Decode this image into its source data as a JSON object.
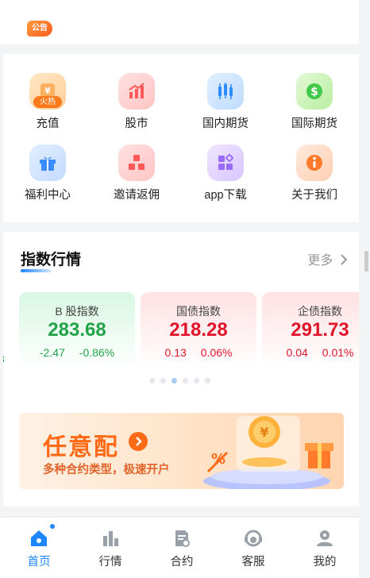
{
  "notice": {
    "badge": "公告"
  },
  "menu": [
    {
      "label": "充值",
      "icon": "recharge-icon",
      "tag": "火热",
      "color": "#ffb05e"
    },
    {
      "label": "股市",
      "icon": "stock-market-icon",
      "color": "#ff5a5a"
    },
    {
      "label": "国内期货",
      "icon": "domestic-futures-icon",
      "color": "#2d8cff"
    },
    {
      "label": "国际期货",
      "icon": "international-futures-icon",
      "color": "#42c84a"
    },
    {
      "label": "福利中心",
      "icon": "gift-icon",
      "color": "#3c8cff"
    },
    {
      "label": "邀请返佣",
      "icon": "invite-icon",
      "color": "#ff5a5a"
    },
    {
      "label": "app下载",
      "icon": "app-download-icon",
      "color": "#9a6bff"
    },
    {
      "label": "关于我们",
      "icon": "info-icon",
      "color": "#ff7a2a"
    }
  ],
  "index": {
    "title": "指数行情",
    "more": "更多",
    "partial_left_chg": "3",
    "cards": [
      {
        "name": "B 股指数",
        "value": "283.68",
        "change": "-2.47",
        "percent": "-0.86%",
        "trend": "down"
      },
      {
        "name": "国债指数",
        "value": "218.28",
        "change": "0.13",
        "percent": "0.06%",
        "trend": "up"
      },
      {
        "name": "企债指数",
        "value": "291.73",
        "change": "0.04",
        "percent": "0.01%",
        "trend": "up"
      }
    ],
    "pager": {
      "count": 6,
      "active": 2
    }
  },
  "banner": {
    "title": "任意配",
    "subtitle": "多种合约类型，极速开户"
  },
  "tabs": [
    {
      "label": "首页",
      "icon": "home-icon",
      "active": true
    },
    {
      "label": "行情",
      "icon": "market-icon"
    },
    {
      "label": "合约",
      "icon": "contract-icon"
    },
    {
      "label": "客服",
      "icon": "customer-service-icon"
    },
    {
      "label": "我的",
      "icon": "profile-icon"
    }
  ]
}
